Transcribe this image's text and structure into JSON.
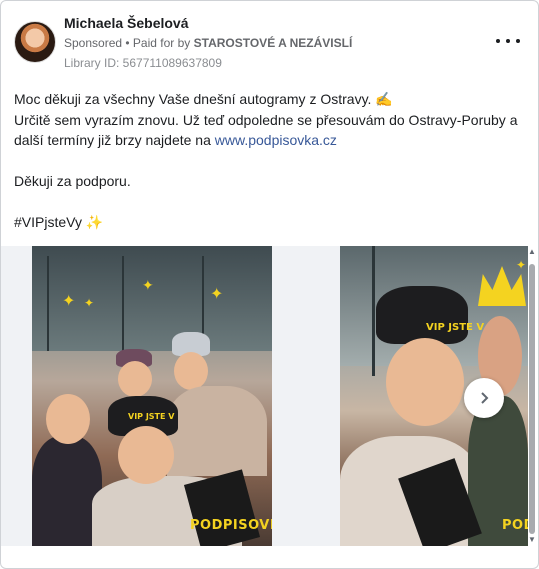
{
  "post": {
    "author": "Michaela Šebelová",
    "sponsored": "Sponsored",
    "paid_for_by_prefix": " • Paid for by ",
    "payer": "STAROSTOVÉ A NEZÁVISLÍ",
    "library_id": "Library ID: 567711089637809",
    "more_icon": "more-options-icon"
  },
  "body": {
    "line1": "Moc děkuji za všechny Vaše dnešní autogramy z Ostravy. ✍️",
    "line2_prefix": "Určitě sem vyrazím znovu. Už teď odpoledne se přesouvám do Ostravy-Poruby a další termíny již brzy najdete na ",
    "link": "www.podpisovka.cz",
    "line3": "Děkuji za podporu.",
    "hashtag": "#VIPjsteVy ✨"
  },
  "carousel": {
    "slide1_brand": "PODPISOVKA",
    "slide1_hat_label": "VIP JSTE V",
    "slide2_brand": "PODPISOVKA",
    "slide2_hat_label": "VIP JSTE V",
    "next_icon": "chevron-right-icon"
  }
}
